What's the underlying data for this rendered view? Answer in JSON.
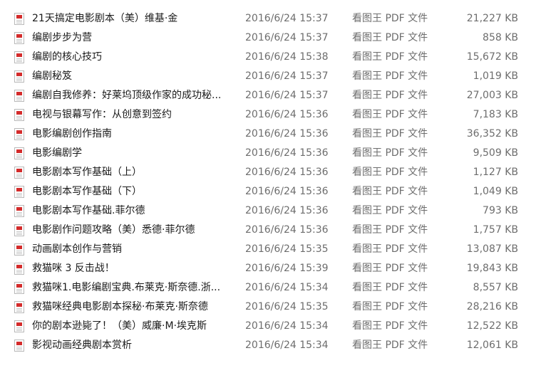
{
  "files": [
    {
      "name": "21天搞定电影剧本（美）维基·金",
      "date": "2016/6/24 15:37",
      "type": "看图王 PDF 文件",
      "size": "21,227 KB"
    },
    {
      "name": "编剧步步为营",
      "date": "2016/6/24 15:37",
      "type": "看图王 PDF 文件",
      "size": "858 KB"
    },
    {
      "name": "编剧的核心技巧",
      "date": "2016/6/24 15:38",
      "type": "看图王 PDF 文件",
      "size": "15,672 KB"
    },
    {
      "name": "编剧秘笈",
      "date": "2016/6/24 15:37",
      "type": "看图王 PDF 文件",
      "size": "1,019 KB"
    },
    {
      "name": "编剧自我修养：好莱坞顶级作家的成功秘...",
      "date": "2016/6/24 15:37",
      "type": "看图王 PDF 文件",
      "size": "27,003 KB"
    },
    {
      "name": "电视与银幕写作：从创意到签约",
      "date": "2016/6/24 15:36",
      "type": "看图王 PDF 文件",
      "size": "7,183 KB"
    },
    {
      "name": "电影编剧创作指南",
      "date": "2016/6/24 15:36",
      "type": "看图王 PDF 文件",
      "size": "36,352 KB"
    },
    {
      "name": "电影编剧学",
      "date": "2016/6/24 15:36",
      "type": "看图王 PDF 文件",
      "size": "9,509 KB"
    },
    {
      "name": "电影剧本写作基础（上）",
      "date": "2016/6/24 15:36",
      "type": "看图王 PDF 文件",
      "size": "1,127 KB"
    },
    {
      "name": "电影剧本写作基础（下）",
      "date": "2016/6/24 15:36",
      "type": "看图王 PDF 文件",
      "size": "1,049 KB"
    },
    {
      "name": "电影剧本写作基础.菲尔德",
      "date": "2016/6/24 15:36",
      "type": "看图王 PDF 文件",
      "size": "793 KB"
    },
    {
      "name": "电影剧作问题攻略（美）悉德·菲尔德",
      "date": "2016/6/24 15:36",
      "type": "看图王 PDF 文件",
      "size": "1,757 KB"
    },
    {
      "name": "动画剧本创作与营销",
      "date": "2016/6/24 15:35",
      "type": "看图王 PDF 文件",
      "size": "13,087 KB"
    },
    {
      "name": "救猫咪 3 反击战！",
      "date": "2016/6/24 15:39",
      "type": "看图王 PDF 文件",
      "size": "19,843 KB"
    },
    {
      "name": "救猫咪1.电影编剧宝典.布莱克·斯奈德.浙...",
      "date": "2016/6/24 15:34",
      "type": "看图王 PDF 文件",
      "size": "8,557 KB"
    },
    {
      "name": "救猫咪经典电影剧本探秘·布莱克·斯奈德",
      "date": "2016/6/24 15:35",
      "type": "看图王 PDF 文件",
      "size": "28,216 KB"
    },
    {
      "name": "你的剧本逊毙了！（美）威廉·M·埃克斯",
      "date": "2016/6/24 15:34",
      "type": "看图王 PDF 文件",
      "size": "12,522 KB"
    },
    {
      "name": "影视动画经典剧本赏析",
      "date": "2016/6/24 15:34",
      "type": "看图王 PDF 文件",
      "size": "12,061 KB"
    }
  ],
  "icons": {
    "file": "pdf-file-icon",
    "accent": "#d42b2b"
  }
}
